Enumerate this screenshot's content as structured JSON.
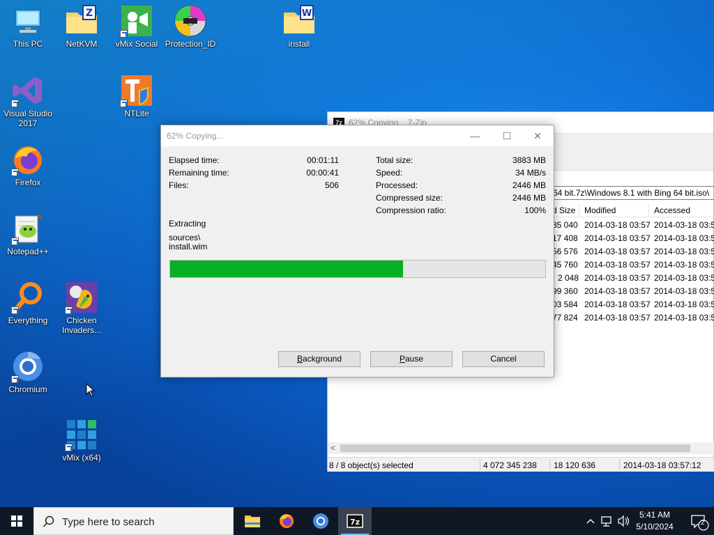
{
  "desktop": {
    "icons": [
      {
        "label": "This PC"
      },
      {
        "label": "NetKVM"
      },
      {
        "label": "vMix Social"
      },
      {
        "label": "Protection_ID"
      },
      {
        "label": "install"
      },
      {
        "label": "Visual Studio 2017"
      },
      {
        "label": "NTLite"
      },
      {
        "label": "Firefox"
      },
      {
        "label": "Notepad++"
      },
      {
        "label": "Everything"
      },
      {
        "label": "Chicken Invaders..."
      },
      {
        "label": "Chromium"
      },
      {
        "label": "vMix (x64)"
      }
    ]
  },
  "main_window": {
    "title": "62% Copying... 7-Zip",
    "app_badge": "7z",
    "path": "64 bit.7z\\Windows 8.1 with Bing 64 bit.iso\\",
    "columns": [
      "d Size",
      "Modified",
      "Accessed"
    ],
    "rows": [
      {
        "size": "35 040",
        "modified": "2014-03-18 03:57",
        "accessed": "2014-03-18 03:57"
      },
      {
        "size": "17 408",
        "modified": "2014-03-18 03:57",
        "accessed": "2014-03-18 03:57"
      },
      {
        "size": "56 576",
        "modified": "2014-03-18 03:57",
        "accessed": "2014-03-18 03:57"
      },
      {
        "size": "45 760",
        "modified": "2014-03-18 03:57",
        "accessed": "2014-03-18 03:57"
      },
      {
        "size": "2 048",
        "modified": "2014-03-18 03:57",
        "accessed": "2014-03-18 03:57"
      },
      {
        "size": "99 360",
        "modified": "2014-03-18 03:57",
        "accessed": "2014-03-18 03:57"
      },
      {
        "size": "03 584",
        "modified": "2014-03-18 03:57",
        "accessed": "2014-03-18 03:57"
      },
      {
        "size": "77 824",
        "modified": "2014-03-18 03:57",
        "accessed": "2014-03-18 03:57"
      }
    ],
    "scroll_left_glyph": "<",
    "status": {
      "selected": "8 / 8 object(s) selected",
      "total": "4 072 345 238",
      "packed": "18 120 636",
      "modified": "2014-03-18 03:57:12"
    }
  },
  "dialog": {
    "title": "62% Copying...",
    "window_buttons": {
      "minimize": "—",
      "maximize": "☐",
      "close": "✕"
    },
    "left_stats": [
      {
        "label": "Elapsed time:",
        "value": "00:01:11"
      },
      {
        "label": "Remaining time:",
        "value": "00:00:41"
      },
      {
        "label": "Files:",
        "value": "506"
      }
    ],
    "right_stats": [
      {
        "label": "Total size:",
        "value": "3883 MB"
      },
      {
        "label": "Speed:",
        "value": "34 MB/s"
      },
      {
        "label": "Processed:",
        "value": "2446 MB"
      },
      {
        "label": "Compressed size:",
        "value": "2446 MB"
      },
      {
        "label": "Compression ratio:",
        "value": "100%"
      }
    ],
    "operation": "Extracting",
    "current_path": "sources\\",
    "current_file": "install.wim",
    "progress_percent": 62,
    "buttons": {
      "background": {
        "key": "B",
        "rest": "ackground"
      },
      "pause": {
        "key": "P",
        "rest": "ause"
      },
      "cancel": {
        "key": "",
        "rest": "Cancel"
      }
    }
  },
  "taskbar": {
    "search_placeholder": "Type here to search",
    "time": "5:41 AM",
    "date": "5/10/2024",
    "notification_count": "2"
  },
  "colors": {
    "progress_fill": "#06b025",
    "taskbar": "#101826",
    "desktop_blue": "#0f6fd8"
  }
}
